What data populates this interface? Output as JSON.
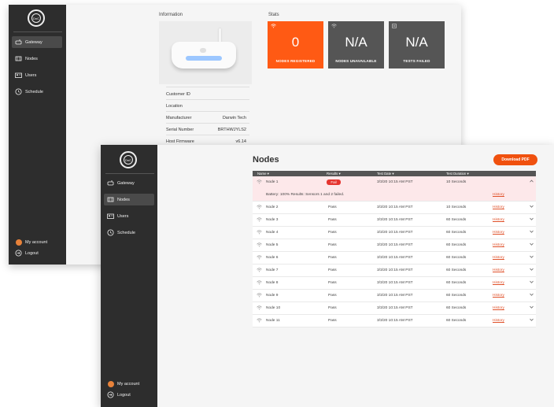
{
  "back": {
    "logo_text": "DnC",
    "nav": [
      {
        "label": "Gateway",
        "icon": "router-icon",
        "active": true
      },
      {
        "label": "Nodes",
        "icon": "nodes-icon",
        "active": false
      },
      {
        "label": "Users",
        "icon": "users-icon",
        "active": false
      },
      {
        "label": "Schedule",
        "icon": "clock-icon",
        "active": false
      }
    ],
    "account": {
      "label": "My account"
    },
    "logout": {
      "label": "Logout"
    },
    "info_title": "Information",
    "stats_title": "Stats",
    "info": [
      {
        "label": "Customer ID",
        "value": ""
      },
      {
        "label": "Location",
        "value": ""
      },
      {
        "label": "Manufacturer",
        "value": "Darwin Tech"
      },
      {
        "label": "Serial Number",
        "value": "BRTHWJYLS2"
      },
      {
        "label": "Host Firmware",
        "value": "v6.14"
      }
    ],
    "stats": [
      {
        "value": "0",
        "label": "NODES REGISTERED",
        "color": "#ff5a14"
      },
      {
        "value": "N/A",
        "label": "NODES UNAVAILABLE",
        "color": "#555555"
      },
      {
        "value": "N/A",
        "label": "TESTS FAILED",
        "color": "#555555"
      }
    ]
  },
  "front": {
    "logo_text": "DnC",
    "nav": [
      {
        "label": "Gateway",
        "active": false
      },
      {
        "label": "Nodes",
        "active": true
      },
      {
        "label": "Users",
        "active": false
      },
      {
        "label": "Schedule",
        "active": false
      }
    ],
    "account": {
      "label": "My account"
    },
    "logout": {
      "label": "Logout"
    },
    "title": "Nodes",
    "download_label": "Download PDF",
    "columns": [
      "Name ▾",
      "Results ▾",
      "Test Date ▾",
      "Test Duration ▾"
    ],
    "rows": [
      {
        "name": "Node 1",
        "result": "Fail",
        "date": "3/3/20   10:15 AM PST",
        "duration": "10 Seconds",
        "history": "History",
        "expanded": true,
        "detail": "Battery: 100%    Results:  Sensors 1 and 2 failed."
      },
      {
        "name": "Node 2",
        "result": "Pass",
        "date": "3/3/20   10:15 AM PST",
        "duration": "10 Seconds",
        "history": "History"
      },
      {
        "name": "Node 3",
        "result": "Pass",
        "date": "3/3/20   10:15 AM PST",
        "duration": "60 Seconds",
        "history": "History"
      },
      {
        "name": "Node 4",
        "result": "Pass",
        "date": "3/3/20   10:15 AM PST",
        "duration": "60 Seconds",
        "history": "History"
      },
      {
        "name": "Node 5",
        "result": "Pass",
        "date": "3/3/20   10:15 AM PST",
        "duration": "60 Seconds",
        "history": "History"
      },
      {
        "name": "Node 6",
        "result": "Pass",
        "date": "3/3/20   10:15 AM PST",
        "duration": "60 Seconds",
        "history": "History"
      },
      {
        "name": "Node 7",
        "result": "Pass",
        "date": "3/3/20   10:15 AM PST",
        "duration": "60 Seconds",
        "history": "History"
      },
      {
        "name": "Node 8",
        "result": "Pass",
        "date": "3/3/20   10:15 AM PST",
        "duration": "60 Seconds",
        "history": "History"
      },
      {
        "name": "Node 9",
        "result": "Pass",
        "date": "3/3/20   10:15 AM PST",
        "duration": "60 Seconds",
        "history": "History"
      },
      {
        "name": "Node 10",
        "result": "Pass",
        "date": "3/3/20   10:15 AM PST",
        "duration": "60 Seconds",
        "history": "History"
      },
      {
        "name": "Node 11",
        "result": "Pass",
        "date": "3/3/20   10:15 AM PST",
        "duration": "60 Seconds",
        "history": "History"
      }
    ],
    "colors": {
      "accent": "#f0510f",
      "fail": "#e5342f",
      "sidebar": "#2d2d2d"
    }
  }
}
